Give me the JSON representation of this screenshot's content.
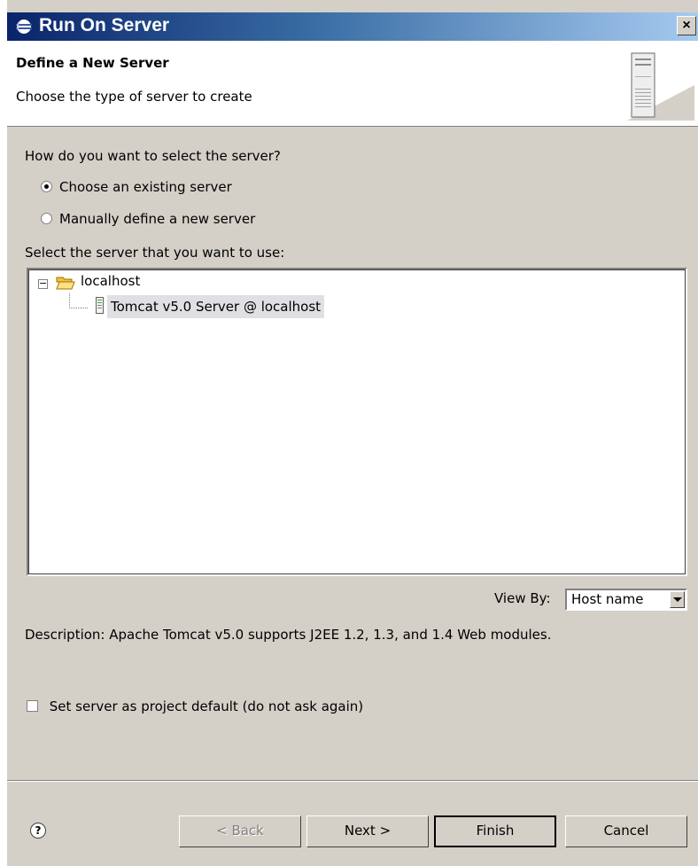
{
  "window": {
    "title": "Run On Server",
    "close": "×"
  },
  "header": {
    "title": "Define a New Server",
    "description": "Choose the type of server to create"
  },
  "selection": {
    "question": "How do you want to select the server?",
    "options": [
      {
        "label": "Choose an existing server",
        "checked": true
      },
      {
        "label": "Manually define a new server",
        "checked": false
      }
    ]
  },
  "server_list": {
    "label": "Select the server that you want to use:",
    "tree": [
      {
        "label": "localhost",
        "expander": "−",
        "children": [
          {
            "label": "Tomcat v5.0 Server @ localhost",
            "selected": true
          }
        ]
      }
    ]
  },
  "view_by": {
    "label": "View By:",
    "value": "Host name"
  },
  "description": "Description: Apache Tomcat v5.0 supports J2EE 1.2, 1.3, and 1.4 Web modules.",
  "project_default": {
    "label": "Set server as project default (do not ask again)",
    "checked": false
  },
  "buttons": {
    "help": "?",
    "back": "< Back",
    "next": "Next >",
    "finish": "Finish",
    "cancel": "Cancel"
  },
  "icons": {
    "title": "eclipse-icon",
    "header": "server-graphic-icon",
    "folder": "folder-open-icon",
    "server": "server-icon",
    "help": "help-icon"
  },
  "colors": {
    "titlebar_start": "#0a246a",
    "titlebar_end": "#a6caf0",
    "dialog_bg": "#d4d0c8",
    "selection_bg": "#e0dfe3"
  }
}
